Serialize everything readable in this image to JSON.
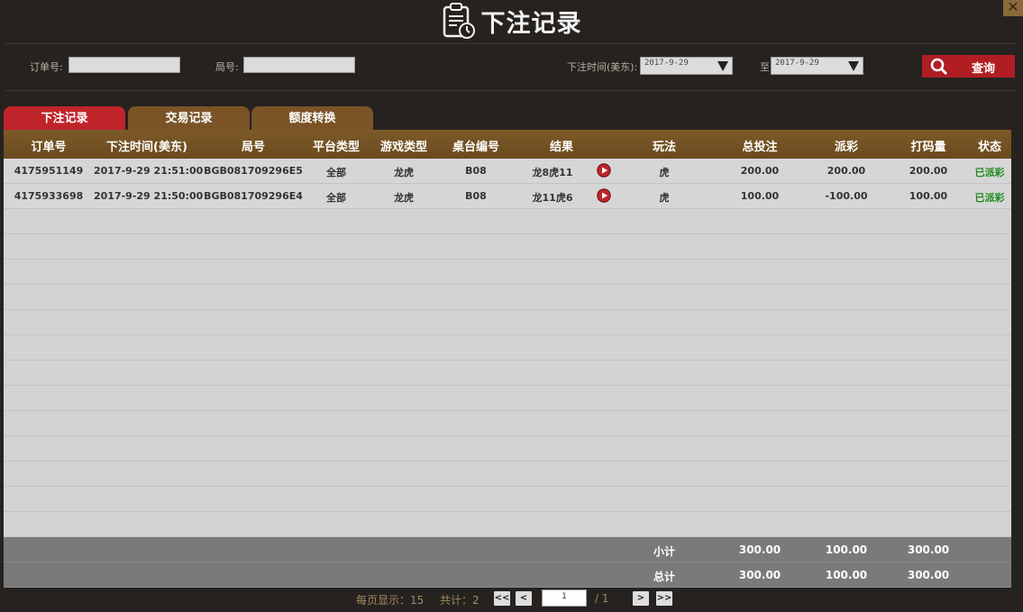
{
  "header": {
    "title": "下注记录",
    "close_label": "✕"
  },
  "search": {
    "order_label": "订单号:",
    "order_value": "",
    "round_label": "局号:",
    "round_value": "",
    "time_label": "下注时间(美东):",
    "date_from": "2017-9-29",
    "to_label": "至",
    "date_to": "2017-9-29",
    "query_label": "查询"
  },
  "tabs": [
    {
      "label": "下注记录",
      "active": true
    },
    {
      "label": "交易记录",
      "active": false
    },
    {
      "label": "额度转换",
      "active": false
    }
  ],
  "table": {
    "columns": [
      "订单号",
      "下注时间(美东)",
      "局号",
      "平台类型",
      "游戏类型",
      "桌台编号",
      "结果",
      "玩法",
      "总投注",
      "派彩",
      "打码量",
      "状态"
    ],
    "rows": [
      {
        "order": "4175951149",
        "time": "2017-9-29 21:51:00",
        "round": "BGB081709296E5",
        "platform": "全部",
        "game": "龙虎",
        "table_no": "B08",
        "result": "龙8虎11",
        "play": "虎",
        "bet": "200.00",
        "payout": "200.00",
        "valid": "200.00",
        "status": "已派彩"
      },
      {
        "order": "4175933698",
        "time": "2017-9-29 21:50:00",
        "round": "BGB081709296E4",
        "platform": "全部",
        "game": "龙虎",
        "table_no": "B08",
        "result": "龙11虎6",
        "play": "虎",
        "bet": "100.00",
        "payout": "-100.00",
        "valid": "100.00",
        "status": "已派彩"
      }
    ],
    "subtotal": {
      "label": "小计",
      "bet": "300.00",
      "payout": "100.00",
      "valid": "300.00"
    },
    "total": {
      "label": "总计",
      "bet": "300.00",
      "payout": "100.00",
      "valid": "300.00"
    }
  },
  "pager": {
    "per_page": "每页显示：15",
    "total": "共计：2",
    "first": "<<",
    "prev": "<",
    "page": "1",
    "of": "/ 1",
    "next": ">",
    "last": ">>"
  },
  "colors": {
    "accent_red": "#b01e24",
    "header_brown": "#7c5a28",
    "status_green": "#1e8a1e"
  }
}
